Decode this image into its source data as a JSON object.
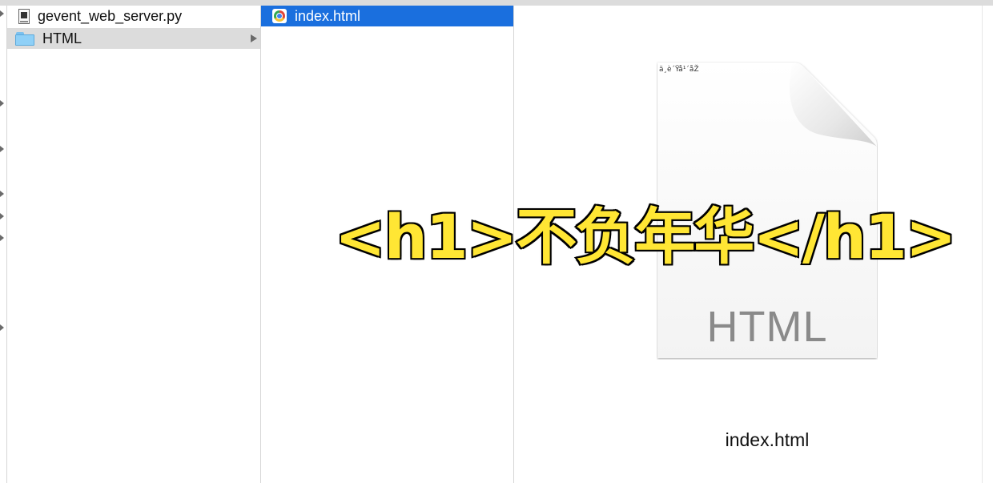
{
  "column1": {
    "items": [
      {
        "label": "gevent_web_server.py",
        "icon": "python-file-icon",
        "selected": false
      },
      {
        "label": "HTML",
        "icon": "folder-icon",
        "selected": "inactive"
      }
    ]
  },
  "column2": {
    "items": [
      {
        "label": "index.html",
        "icon": "chrome-html-icon",
        "selected": true
      }
    ]
  },
  "preview": {
    "doc_garbled_text": "ä¸è´Ÿå¹´åŽ",
    "doc_type_label": "HTML",
    "file_name": "index.html"
  },
  "overlay": {
    "caption": "<h1>不负年华</h1>"
  },
  "colors": {
    "selection_blue": "#1a6fde",
    "selection_gray": "#dcdcdc",
    "caption_fill": "#ffe634",
    "caption_stroke": "#000000"
  }
}
